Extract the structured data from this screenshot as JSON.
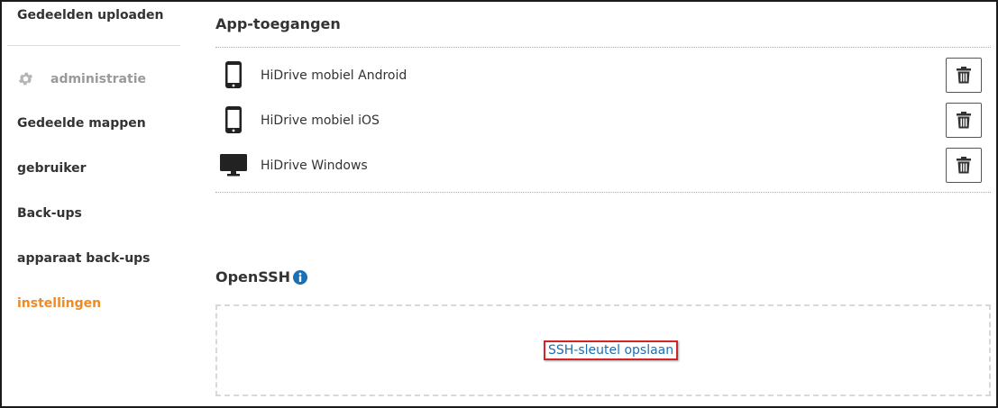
{
  "sidebar": {
    "top_item": "Gedeelden uploaden",
    "admin_heading": "administratie",
    "admin_icon": "gear-icon",
    "items": [
      {
        "label": "Gedeelde mappen",
        "active": false
      },
      {
        "label": "gebruiker",
        "active": false
      },
      {
        "label": "Back-ups",
        "active": false
      },
      {
        "label": "apparaat back-ups",
        "active": false
      },
      {
        "label": "instellingen",
        "active": true
      }
    ],
    "active_color": "#f08a24"
  },
  "app_access": {
    "title": "App-toegangen",
    "apps": [
      {
        "name": "HiDrive mobiel Android",
        "icon": "smartphone-icon"
      },
      {
        "name": "HiDrive mobiel iOS",
        "icon": "smartphone-icon"
      },
      {
        "name": "HiDrive Windows",
        "icon": "desktop-monitor-icon"
      }
    ],
    "delete_icon": "trash-icon"
  },
  "openssh": {
    "title": "OpenSSH",
    "info_icon": "info-icon",
    "save_key_link": "SSH-sleutel opslaan",
    "link_color": "#1a6fb5",
    "highlight_color": "#d6232a"
  }
}
